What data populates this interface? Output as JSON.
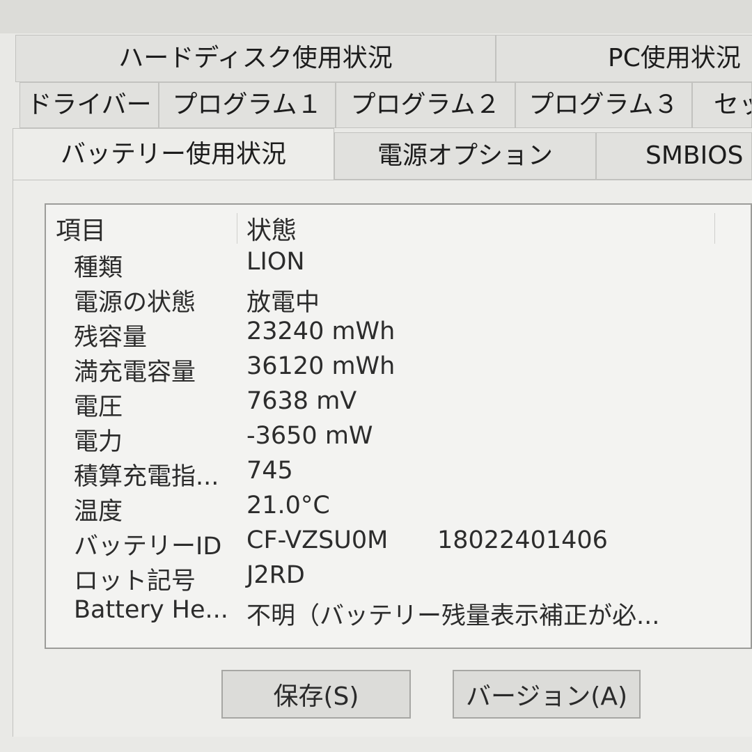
{
  "tabs_row1": [
    "ハードディスク使用状況",
    "PC使用状況"
  ],
  "tabs_row2": [
    "ドライバー",
    "プログラム１",
    "プログラム２",
    "プログラム３",
    "セッ"
  ],
  "tabs_row3": [
    "バッテリー使用状況",
    "電源オプション",
    "SMBIOS"
  ],
  "active_tab": "バッテリー使用状況",
  "table": {
    "headers": [
      "項目",
      "状態"
    ],
    "rows": [
      {
        "key": "種類",
        "value": "LION",
        "extra": ""
      },
      {
        "key": "電源の状態",
        "value": "放電中",
        "extra": ""
      },
      {
        "key": "残容量",
        "value": "23240 mWh",
        "extra": ""
      },
      {
        "key": "満充電容量",
        "value": "36120 mWh",
        "extra": ""
      },
      {
        "key": "電圧",
        "value": "7638 mV",
        "extra": ""
      },
      {
        "key": "電力",
        "value": "-3650 mW",
        "extra": ""
      },
      {
        "key": "積算充電指...",
        "value": "745",
        "extra": ""
      },
      {
        "key": "温度",
        "value": "21.0°C",
        "extra": ""
      },
      {
        "key": "バッテリーID",
        "value": "CF-VZSU0M",
        "extra": "18022401406"
      },
      {
        "key": "ロット記号",
        "value": "J2RD",
        "extra": ""
      },
      {
        "key": "Battery He...",
        "value": "不明（バッテリー残量表示補正が必...",
        "extra": ""
      }
    ]
  },
  "buttons": {
    "save": "保存(S)",
    "version": "バージョン(A)"
  }
}
